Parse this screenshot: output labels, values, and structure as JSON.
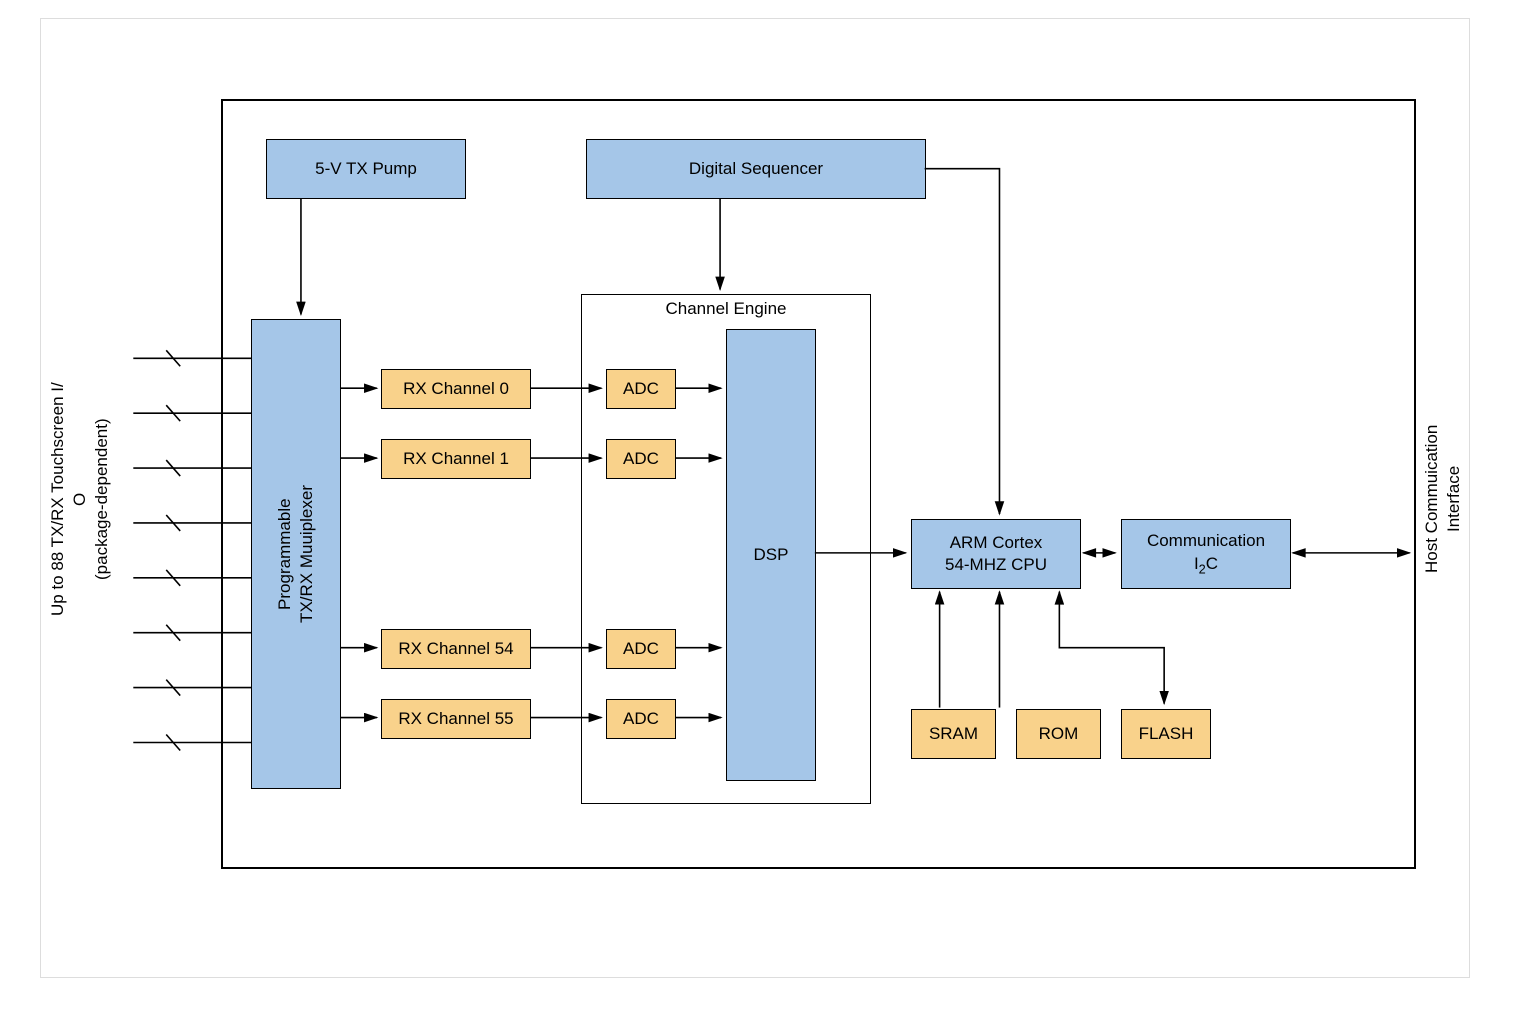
{
  "labels": {
    "left_io": "Up to 88 TX/RX Touchscreen I/\nO\n(package-dependent)",
    "right_io": "Host Commuication\nInterface",
    "tx_pump": "5-V TX Pump",
    "digital_sequencer": "Digital Sequencer",
    "mux": "Programmable\nTX/RX Muuiplexer",
    "channel_engine": "Channel Engine",
    "rx0": "RX Channel 0",
    "rx1": "RX Channel 1",
    "rx54": "RX Channel 54",
    "rx55": "RX Channel 55",
    "adc": "ADC",
    "dsp": "DSP",
    "cpu_line1": "ARM Cortex",
    "cpu_line2": "54-MHZ CPU",
    "comm_line1": "Communication",
    "comm_line2_pre": "I",
    "comm_line2_sub": "2",
    "comm_line2_post": "C",
    "sram": "SRAM",
    "rom": "ROM",
    "flash": "FLASH"
  },
  "diagram": {
    "blocks": [
      {
        "id": "tx_pump",
        "type": "blue"
      },
      {
        "id": "digital_sequencer",
        "type": "blue"
      },
      {
        "id": "mux",
        "type": "blue",
        "vertical": true
      },
      {
        "id": "dsp",
        "type": "blue"
      },
      {
        "id": "cpu",
        "type": "blue"
      },
      {
        "id": "comm",
        "type": "blue"
      },
      {
        "id": "rx0",
        "type": "orange"
      },
      {
        "id": "rx1",
        "type": "orange"
      },
      {
        "id": "rx54",
        "type": "orange"
      },
      {
        "id": "rx55",
        "type": "orange"
      },
      {
        "id": "adc0",
        "type": "orange"
      },
      {
        "id": "adc1",
        "type": "orange"
      },
      {
        "id": "adc54",
        "type": "orange"
      },
      {
        "id": "adc55",
        "type": "orange"
      },
      {
        "id": "sram",
        "type": "orange"
      },
      {
        "id": "rom",
        "type": "orange"
      },
      {
        "id": "flash",
        "type": "orange"
      }
    ],
    "container": "channel_engine",
    "left_io_lines": 8
  }
}
